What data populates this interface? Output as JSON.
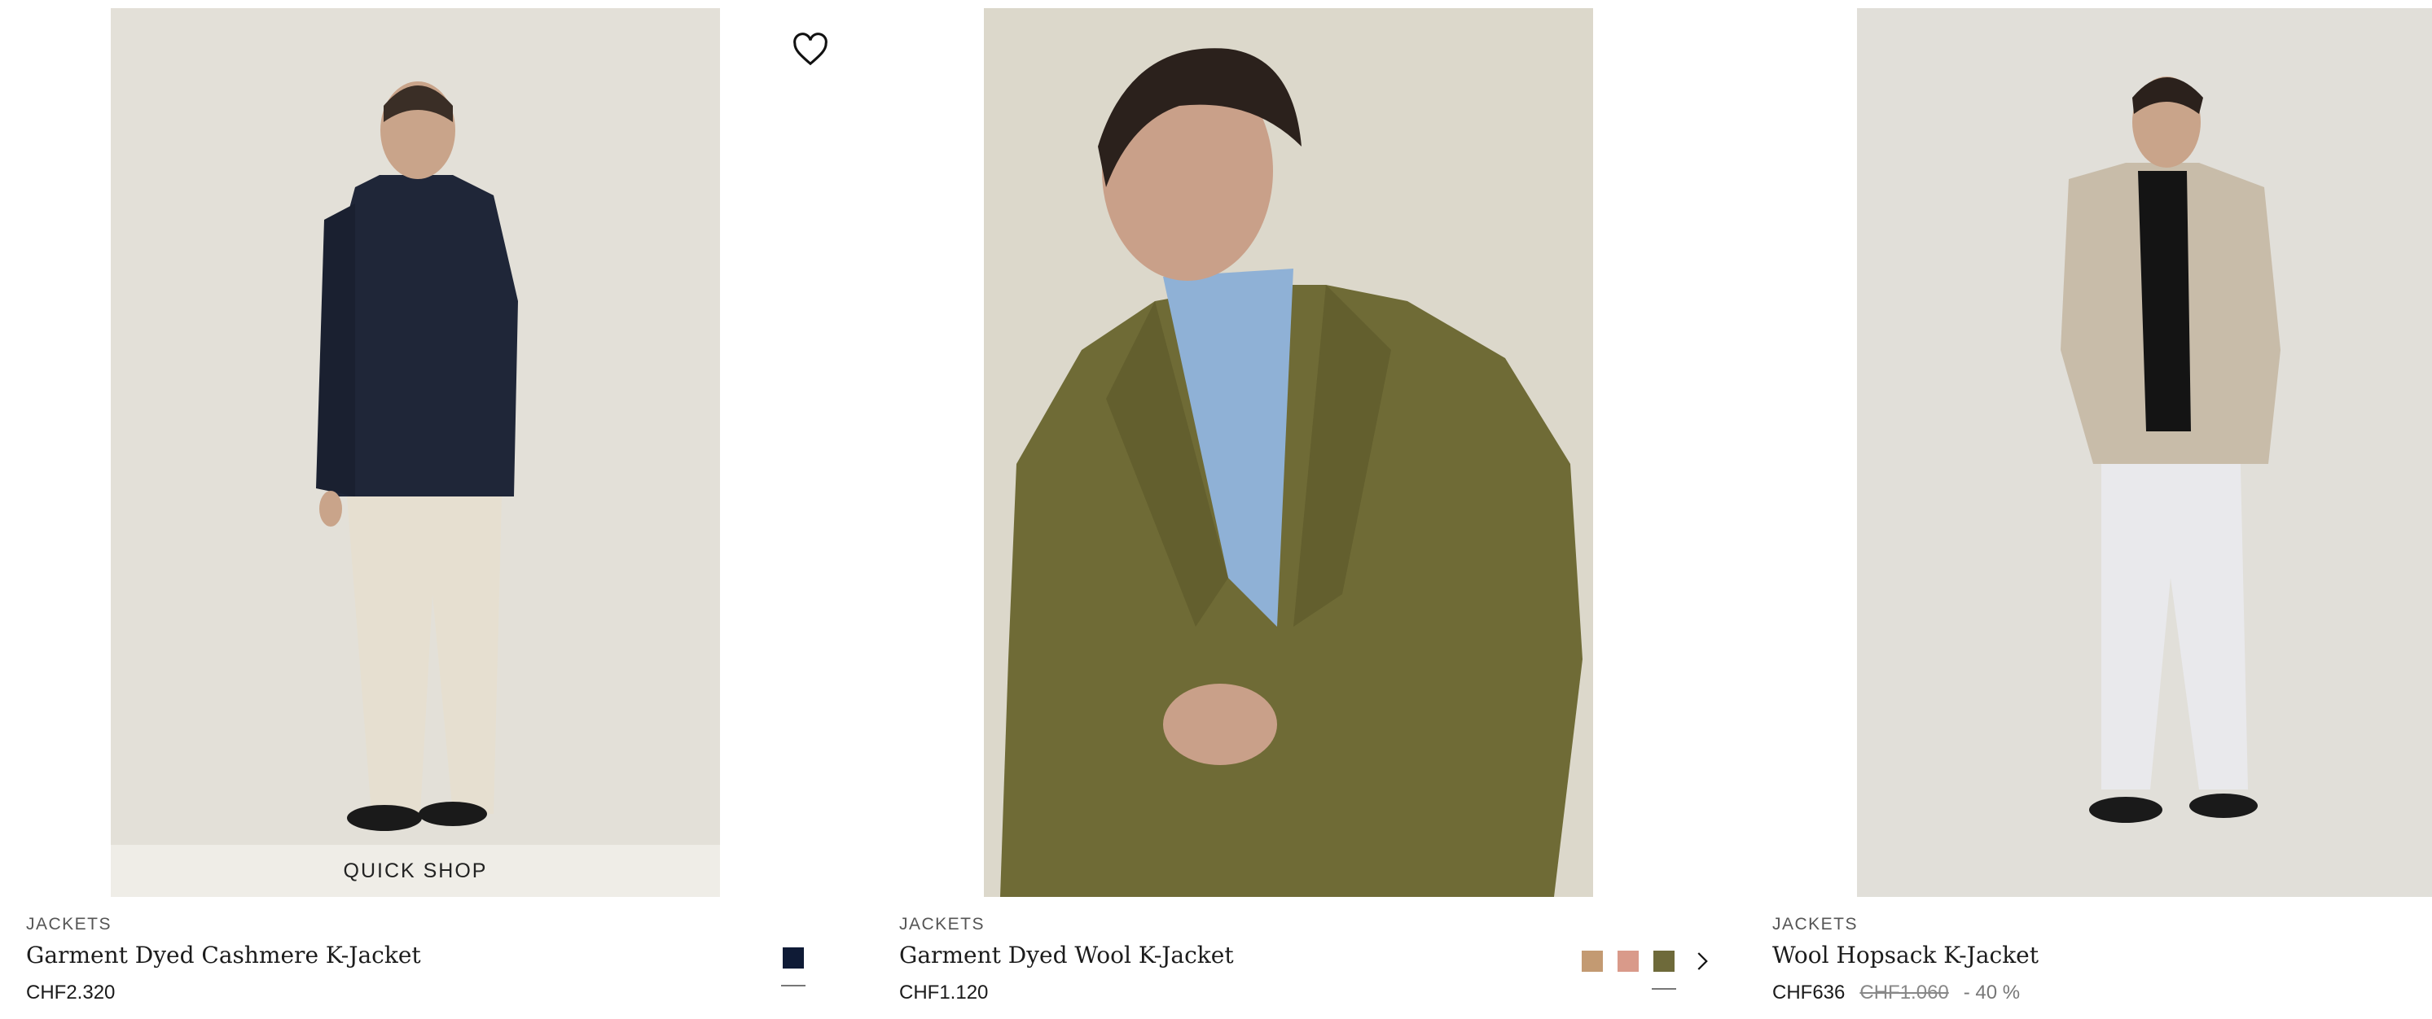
{
  "products": [
    {
      "category": "JACKETS",
      "name": "Garment Dyed Cashmere K-Jacket",
      "price": "CHF2.320",
      "quick_shop": "QUICK SHOP",
      "image_desc": "man in navy jacket and cream trousers, back view",
      "swatches": [
        "#0f1b36"
      ],
      "selected_swatch": 0
    },
    {
      "category": "JACKETS",
      "name": "Garment Dyed Wool K-Jacket",
      "price": "CHF1.120",
      "image_desc": "man in olive green jacket and light blue shirt",
      "swatches": [
        "#c39a72",
        "#d99a8a",
        "#6e6a3a"
      ],
      "selected_swatch": 2
    },
    {
      "category": "JACKETS",
      "name": "Wool Hopsack K-Jacket",
      "price": "CHF636",
      "price_original": "CHF1.060",
      "discount": "- 40 %",
      "image_desc": "man in beige jacket, black tee and white jeans"
    }
  ],
  "icons": {
    "wishlist": "heart-outline-icon",
    "next_colors": "chevron-right-icon"
  }
}
